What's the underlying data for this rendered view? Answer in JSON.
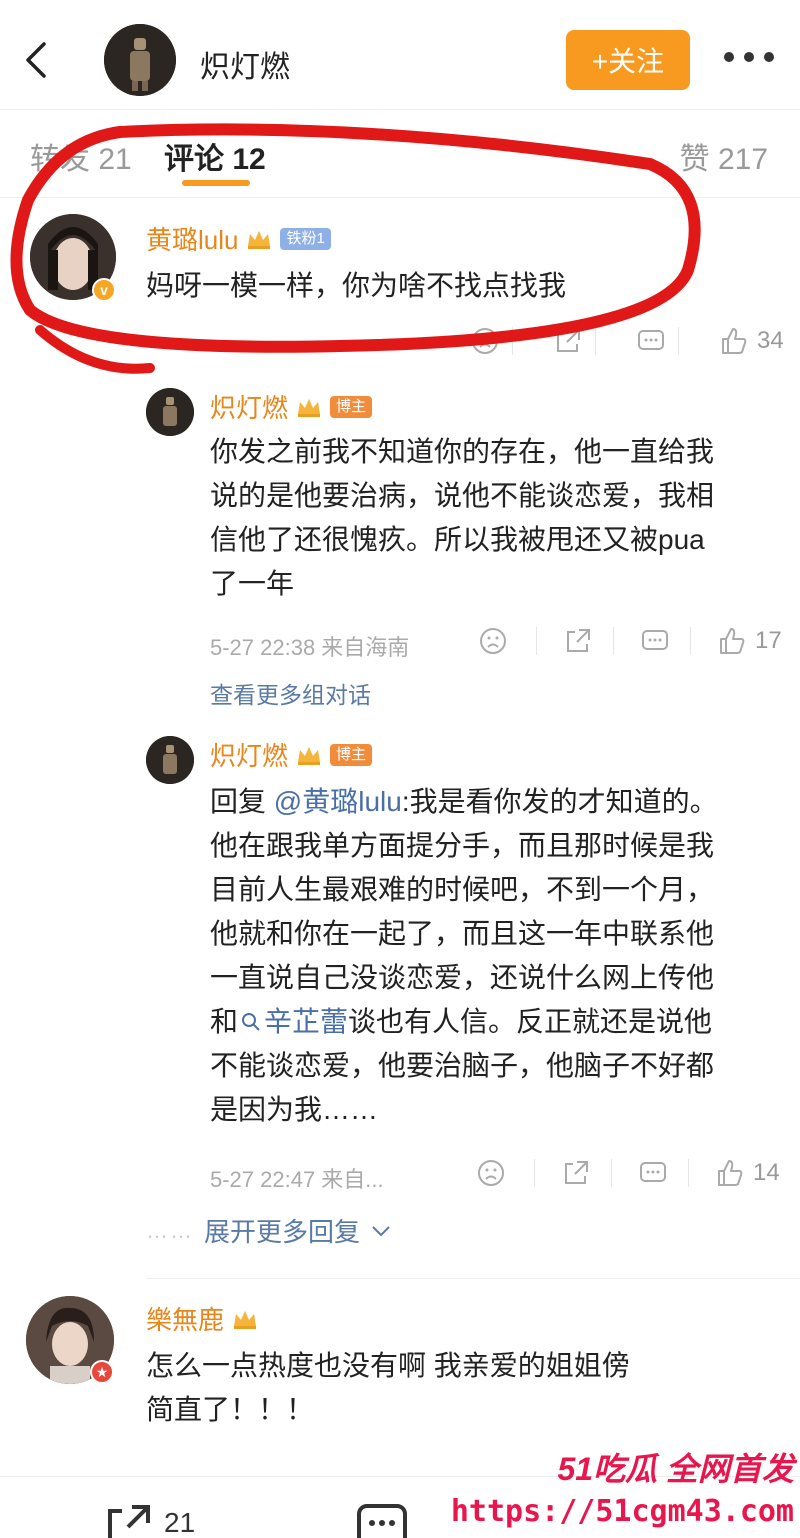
{
  "header": {
    "title": "炽灯燃",
    "follow_label": "+关注"
  },
  "tabs": {
    "repost": "转发 21",
    "comment": "评论 12",
    "like": "赞 217"
  },
  "comments": [
    {
      "user": "黄璐lulu",
      "badge": "铁粉1",
      "text": "妈呀一模一样，你为啥不找点找我",
      "likes": "34"
    }
  ],
  "replies": [
    {
      "user": "炽灯燃",
      "badge": "博主",
      "lines": [
        "你发之前我不知道你的存在，他一直给我",
        "说的是他要治病，说他不能谈恋爱，我相",
        "信他了还很愧疚。所以我被甩还又被pua",
        "了一年"
      ],
      "time": "5-27 22:38 来自海南",
      "likes": "17"
    },
    {
      "user": "炽灯燃",
      "badge": "博主",
      "reply_prefix": "回复",
      "mention": "@黄璐lulu",
      "line1_rest": ":我是看你发的才知道的。",
      "lines_mid": [
        "他在跟我单方面提分手，而且那时候是我",
        "目前人生最艰难的时候吧，不到一个月，",
        "他就和你在一起了，而且这一年中联系他",
        "一直说自己没谈恋爱，还说什么网上传他"
      ],
      "line6_pre": "和",
      "topic": "辛芷蕾",
      "line6_post": "谈也有人信。反正就还是说他",
      "lines_end": [
        "不能谈恋爱，他要治脑子，他脑子不好都",
        "是因为我……"
      ],
      "time": "5-27 22:47 来自...",
      "likes": "14"
    }
  ],
  "more_conversation": "查看更多组对话",
  "expand_replies": "展开更多回复",
  "expand_dots": "……",
  "comment2": {
    "user": "樂無鹿",
    "lines": [
      "怎么一点热度也没有啊 我亲爱的姐姐傍",
      "简直了！！！"
    ]
  },
  "bottom_bar": {
    "repost_count": "21"
  },
  "watermark": {
    "line1": "51吃瓜 全网首发",
    "line2": "https://51cgm43.com"
  },
  "colors": {
    "accent": "#f79a1f",
    "username": "#e8861a",
    "link": "#4a6fa8",
    "annotation": "#e01818"
  }
}
